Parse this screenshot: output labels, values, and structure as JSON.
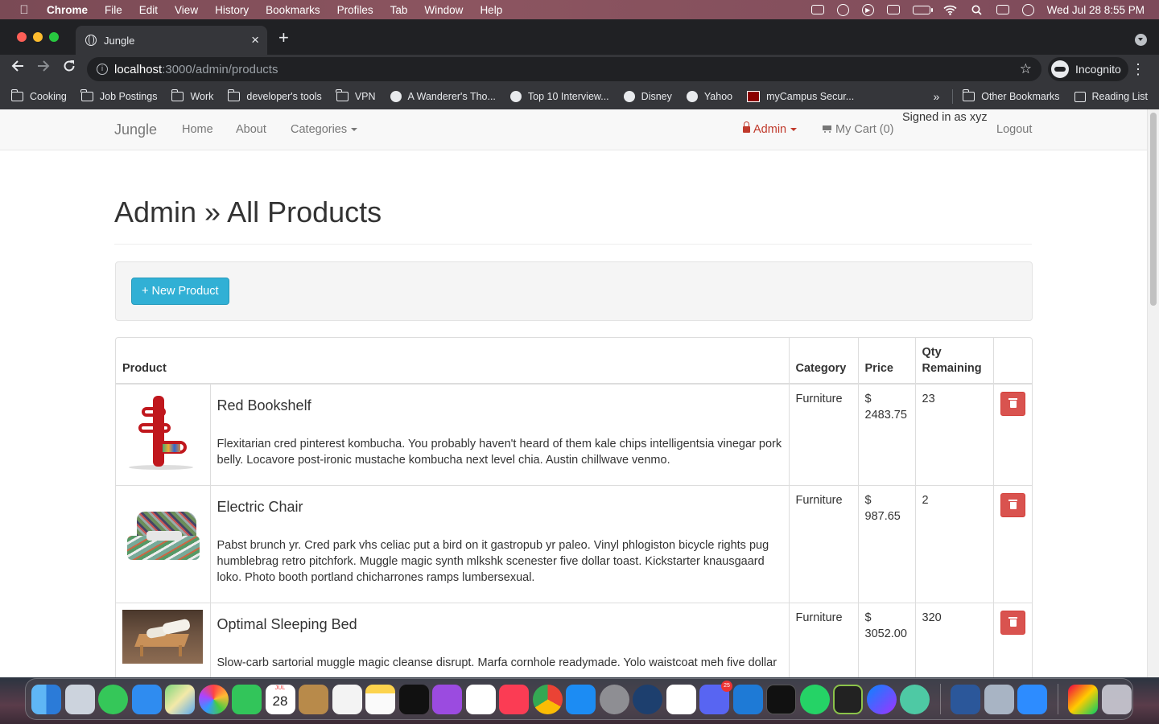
{
  "menubar": {
    "app_name": "Chrome",
    "menus": [
      "File",
      "Edit",
      "View",
      "History",
      "Bookmarks",
      "Profiles",
      "Tab",
      "Window",
      "Help"
    ],
    "clock": "Wed Jul 28  8:55 PM"
  },
  "browser": {
    "tab_title": "Jungle",
    "url_host": "localhost",
    "url_path": ":3000/admin/products",
    "incognito_label": "Incognito",
    "bookmarks": [
      {
        "label": "Cooking",
        "icon": "folder-icon"
      },
      {
        "label": "Job Postings",
        "icon": "folder-icon"
      },
      {
        "label": "Work",
        "icon": "folder-icon"
      },
      {
        "label": "developer's tools",
        "icon": "folder-icon"
      },
      {
        "label": "VPN",
        "icon": "folder-icon"
      },
      {
        "label": "A Wanderer's Tho...",
        "icon": "globe-icon"
      },
      {
        "label": "Top 10 Interview...",
        "icon": "globe-icon"
      },
      {
        "label": "Disney",
        "icon": "globe-icon"
      },
      {
        "label": "Yahoo",
        "icon": "globe-icon"
      },
      {
        "label": "myCampus Secur...",
        "icon": "campus-icon"
      }
    ],
    "bookmarks_overflow": "»",
    "other_bookmarks": "Other Bookmarks",
    "reading_list": "Reading List"
  },
  "navbar": {
    "brand": "Jungle",
    "home": "Home",
    "about": "About",
    "categories": "Categories",
    "admin": "Admin",
    "cart": "My Cart (0)",
    "signed_in": "Signed in as xyz",
    "logout": "Logout",
    "admin_color": "#c0392b"
  },
  "page": {
    "title": "Admin » All Products",
    "new_product_button": "+ New Product"
  },
  "table": {
    "headers": {
      "product": "Product",
      "category": "Category",
      "price": "Price",
      "qty": "Qty Remaining"
    },
    "rows": [
      {
        "name": "Red Bookshelf",
        "description": "Flexitarian cred pinterest kombucha. You probably haven't heard of them kale chips intelligentsia vinegar pork belly. Locavore post-ironic mustache kombucha next level chia. Austin chillwave venmo.",
        "category": "Furniture",
        "price_symbol": "$",
        "price": "2483.75",
        "qty": "23"
      },
      {
        "name": "Electric Chair",
        "description": "Pabst brunch yr. Cred park vhs celiac put a bird on it gastropub yr paleo. Vinyl phlogiston bicycle rights pug humblebrag retro pitchfork. Muggle magic synth mlkshk scenester five dollar toast. Kickstarter knausgaard loko. Photo booth portland chicharrones ramps lumbersexual.",
        "category": "Furniture",
        "price_symbol": "$",
        "price": "987.65",
        "qty": "2"
      },
      {
        "name": "Optimal Sleeping Bed",
        "description": "Slow-carb sartorial muggle magic cleanse disrupt. Marfa cornhole readymade. Yolo waistcoat meh five dollar",
        "category": "Furniture",
        "price_symbol": "$",
        "price": "3052.00",
        "qty": "320"
      }
    ]
  },
  "dock": {
    "calendar_day": "28",
    "discord_badge": "25"
  }
}
